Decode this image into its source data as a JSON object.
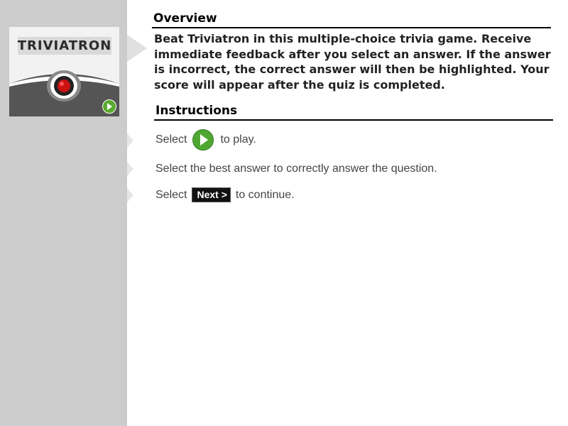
{
  "logo": {
    "title": "TRIVIATRON",
    "play_icon": "play-circle-icon"
  },
  "overview": {
    "heading": "Overview",
    "text": "Beat Triviatron in this multiple-choice trivia game. Receive immediate feedback after you select an answer. If the answer is incorrect, the correct answer will then be highlighted. Your score will appear after the quiz is completed."
  },
  "instructions": {
    "heading": "Instructions",
    "step1": {
      "before": "Select",
      "icon": "play-circle-icon",
      "after": "to play."
    },
    "step2": {
      "text": "Select the best answer to correctly answer the question."
    },
    "step3": {
      "before": "Select",
      "button_label": "Next >",
      "after": "to continue."
    }
  },
  "colors": {
    "sidebar": "#cccccc",
    "play_green": "#4fa732",
    "next_button": "#111111",
    "logo_red": "#cc1111"
  }
}
